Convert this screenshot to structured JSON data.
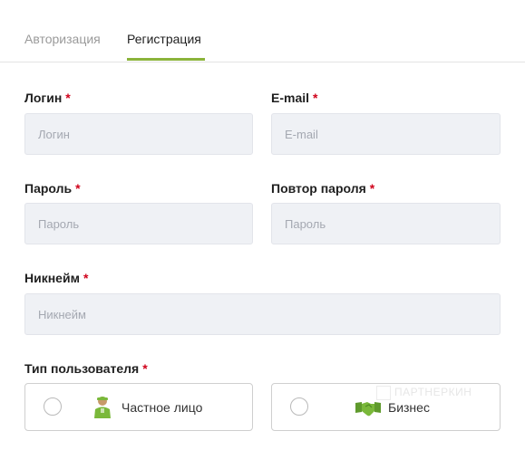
{
  "tabs": [
    {
      "label": "Авторизация",
      "active": false
    },
    {
      "label": "Регистрация",
      "active": true
    }
  ],
  "form": {
    "login": {
      "label": "Логин",
      "required_mark": "*",
      "placeholder": "Логин",
      "value": ""
    },
    "email": {
      "label": "E-mail",
      "required_mark": "*",
      "placeholder": "E-mail",
      "value": ""
    },
    "password": {
      "label": "Пароль",
      "required_mark": "*",
      "placeholder": "Пароль",
      "value": ""
    },
    "password_repeat": {
      "label": "Повтор пароля",
      "required_mark": "*",
      "placeholder": "Пароль",
      "value": ""
    },
    "nickname": {
      "label": "Никнейм",
      "required_mark": "*",
      "placeholder": "Никнейм",
      "value": ""
    },
    "user_type": {
      "label": "Тип пользователя",
      "required_mark": "*",
      "options": [
        {
          "label": "Частное лицо",
          "icon": "person-icon",
          "selected": false
        },
        {
          "label": "Бизнес",
          "icon": "handshake-icon",
          "selected": false,
          "watermark": "ПАРТНЕРКИН"
        }
      ]
    }
  },
  "colors": {
    "accent": "#8bb33a",
    "required": "#d0021b",
    "input_bg": "#eff1f5",
    "icon_green": "#7ab83a"
  }
}
